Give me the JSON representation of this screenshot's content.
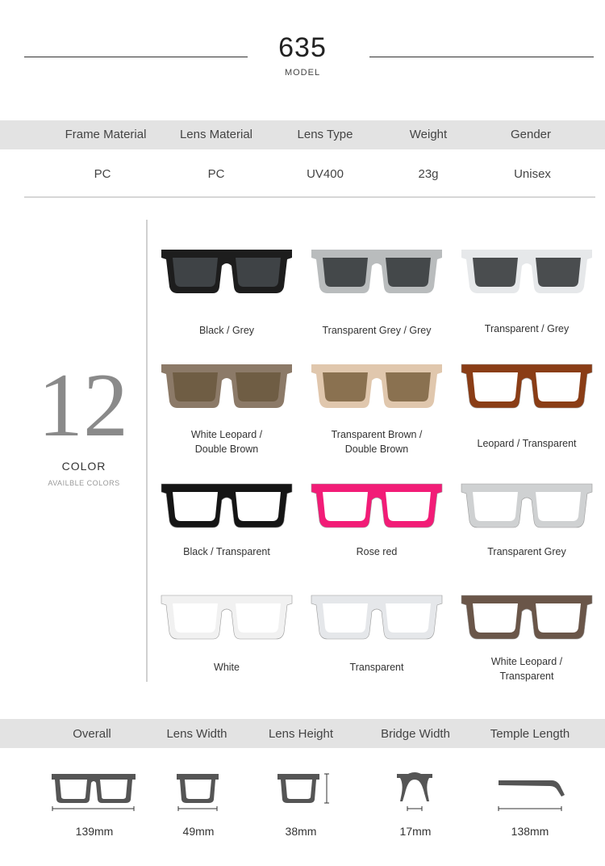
{
  "header": {
    "model_number": "635",
    "model_label": "MODEL"
  },
  "specs": {
    "headers": [
      "Frame Material",
      "Lens Material",
      "Lens Type",
      "Weight",
      "Gender"
    ],
    "values": [
      "PC",
      "PC",
      "UV400",
      "23g",
      "Unisex"
    ]
  },
  "colors": {
    "count": "12",
    "label": "COLOR",
    "sublabel": "AVAILBLE COLORS",
    "items": [
      {
        "label": "Black / Grey",
        "frame": "#1d1d1d",
        "lens": "#3f4346"
      },
      {
        "label": "Transparent Grey / Grey",
        "frame": "#b9bcbd",
        "lens": "#44484a"
      },
      {
        "label": "Transparent / Grey",
        "frame": "#e6e8ea",
        "lens": "#4a4d4f"
      },
      {
        "label": "White Leopard /\nDouble Brown",
        "frame": "#8c7a68",
        "lens": "#6f5d44"
      },
      {
        "label": "Transparent Brown /\nDouble Brown",
        "frame": "#e0c7ad",
        "lens": "#8a7150"
      },
      {
        "label": "Leopard / Transparent",
        "frame": "#8a3d16",
        "lens": "#ffffff"
      },
      {
        "label": "Black / Transparent",
        "frame": "#151515",
        "lens": "#ffffff"
      },
      {
        "label": "Rose red",
        "frame": "#f21c77",
        "lens": "#ffffff"
      },
      {
        "label": "Transparent Grey",
        "frame": "#cfd1d2",
        "lens": "#ffffff"
      },
      {
        "label": "White",
        "frame": "#f1f1f1",
        "lens": "#ffffff"
      },
      {
        "label": "Transparent",
        "frame": "#e5e7ea",
        "lens": "#ffffff"
      },
      {
        "label": "White Leopard /\nTransparent",
        "frame": "#6a5649",
        "lens": "#ffffff"
      }
    ]
  },
  "dimensions": {
    "labels": [
      "Overall",
      "Lens Width",
      "Lens Height",
      "Bridge Width",
      "Temple Length"
    ],
    "values": [
      "139mm",
      "49mm",
      "38mm",
      "17mm",
      "138mm"
    ]
  }
}
